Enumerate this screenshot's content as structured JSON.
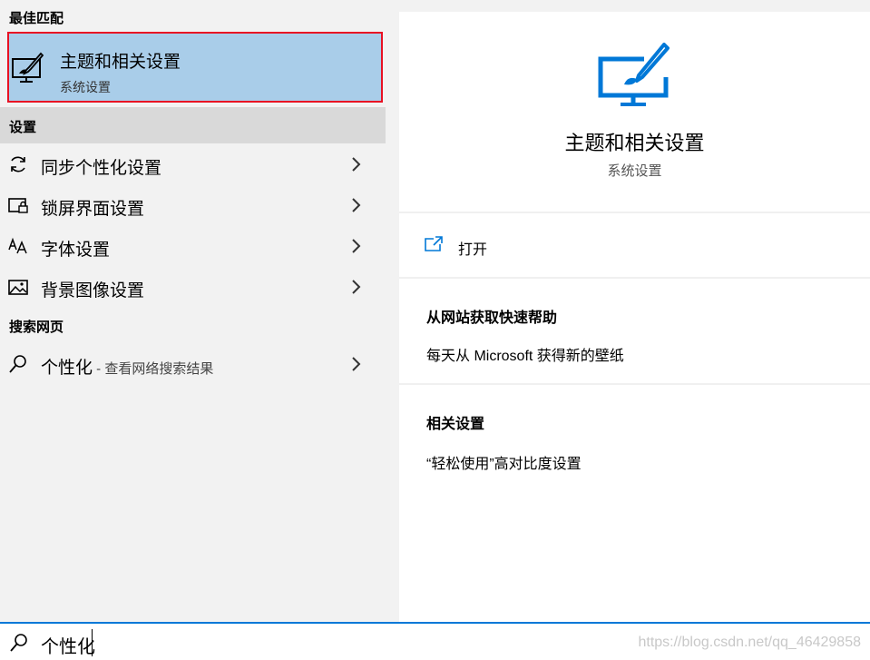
{
  "left": {
    "best_match_header": "最佳匹配",
    "best_match": {
      "title": "主题和相关设置",
      "subtitle": "系统设置",
      "icon": "personalization-icon"
    },
    "settings_header": "设置",
    "settings_items": [
      {
        "label": "同步个性化设置",
        "icon": "sync-icon"
      },
      {
        "label": "锁屏界面设置",
        "icon": "lock-screen-icon"
      },
      {
        "label": "字体设置",
        "icon": "font-icon"
      },
      {
        "label": "背景图像设置",
        "icon": "image-icon"
      }
    ],
    "web_header": "搜索网页",
    "web_item": {
      "label": "个性化",
      "suffix": " - 查看网络搜索结果",
      "icon": "search-icon"
    }
  },
  "right": {
    "title": "主题和相关设置",
    "subtitle": "系统设置",
    "open_label": "打开",
    "help_header": "从网站获取快速帮助",
    "help_link": "每天从 Microsoft 获得新的壁纸",
    "related_header": "相关设置",
    "related_link": "“轻松使用”高对比度设置"
  },
  "search": {
    "value": "个性化"
  },
  "watermark": "https://blog.csdn.net/qq_46429858",
  "colors": {
    "accent": "#0078d7",
    "selected": "#a9cde9",
    "highlight_border": "#e81123"
  }
}
